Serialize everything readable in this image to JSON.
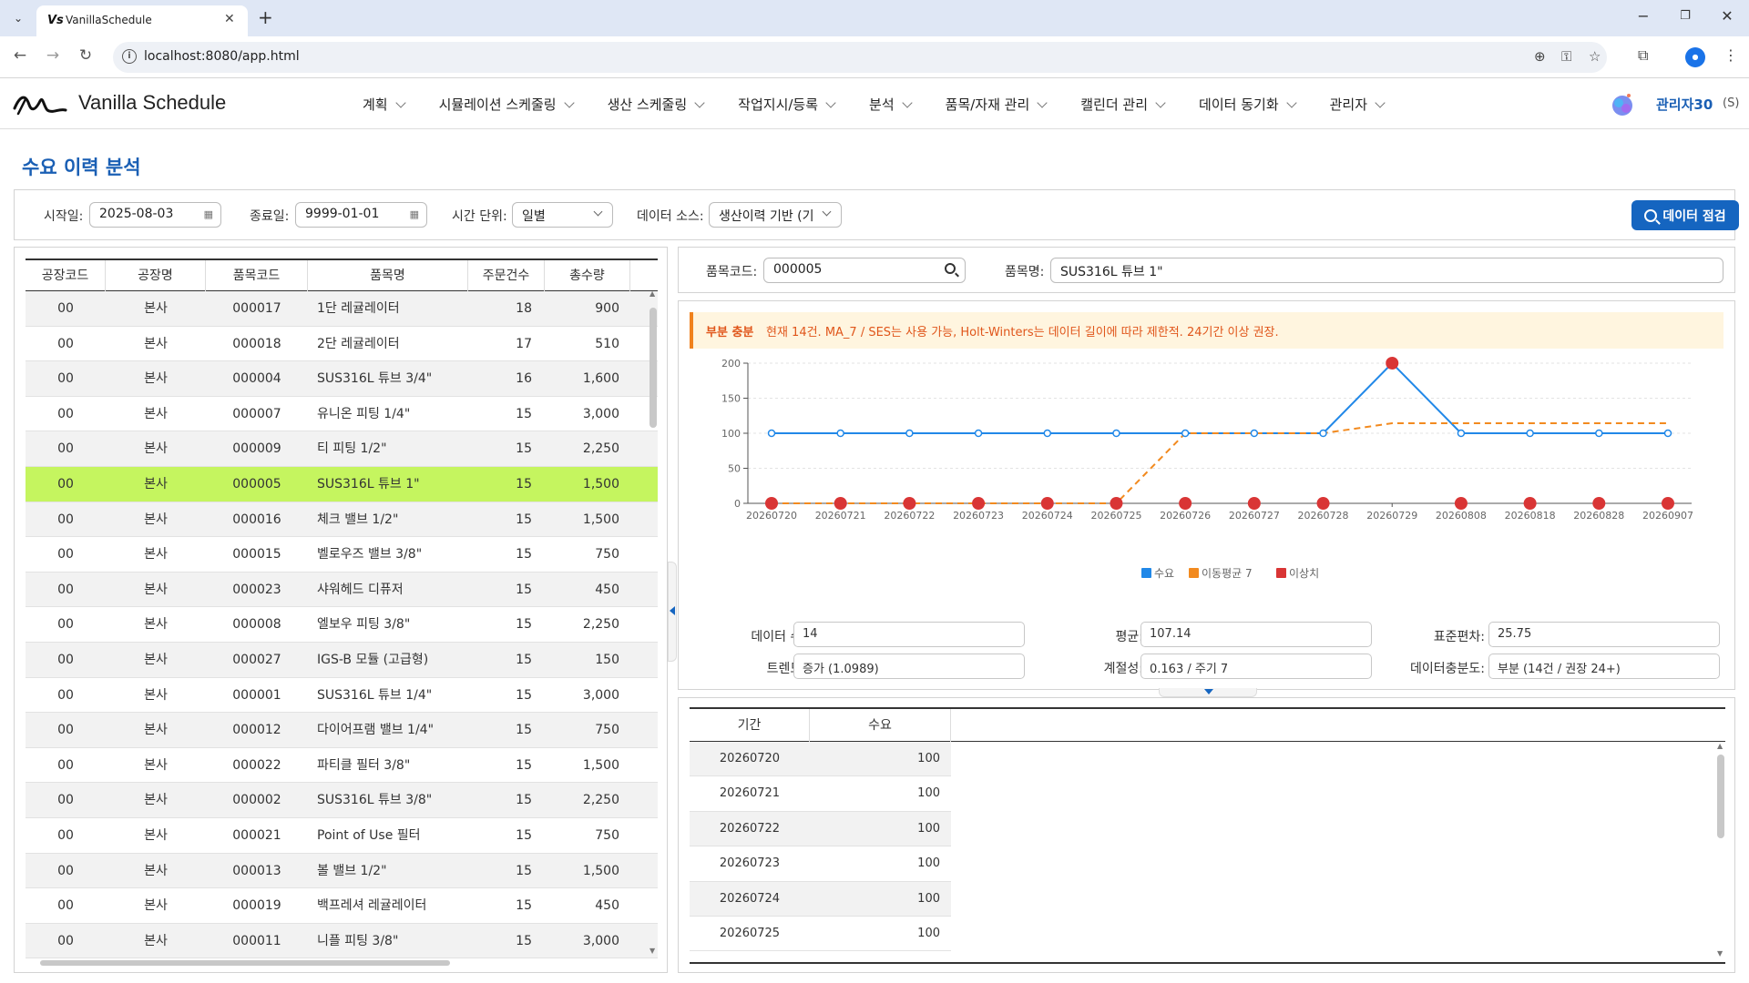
{
  "browser": {
    "tab_title": "VanillaSchedule",
    "url": "localhost:8080/app.html"
  },
  "app": {
    "brand": "Vanilla Schedule",
    "menu": [
      "계획",
      "시뮬레이션 스케줄링",
      "생산 스케줄링",
      "작업지시/등록",
      "분석",
      "품목/자재 관리",
      "캘린더 관리",
      "데이터 동기화",
      "관리자"
    ],
    "user_name": "관리자30",
    "user_suffix": "(S)"
  },
  "page": {
    "title": "수요 이력 분석"
  },
  "filters": {
    "start_label": "시작일:",
    "start_value": "2025-08-03",
    "end_label": "종료일:",
    "end_value": "9999-01-01",
    "unit_label": "시간 단위:",
    "unit_value": "일별",
    "source_label": "데이터 소스:",
    "source_value": "생산이력 기반 (기",
    "check_button": "데이터 점검"
  },
  "left_grid": {
    "columns": [
      "공장코드",
      "공장명",
      "품목코드",
      "품목명",
      "주문건수",
      "총수량"
    ],
    "selected_index": 5,
    "rows": [
      [
        "00",
        "본사",
        "000017",
        "1단 레귤레이터",
        "18",
        "900"
      ],
      [
        "00",
        "본사",
        "000018",
        "2단 레귤레이터",
        "17",
        "510"
      ],
      [
        "00",
        "본사",
        "000004",
        "SUS316L 튜브 3/4\"",
        "16",
        "1,600"
      ],
      [
        "00",
        "본사",
        "000007",
        "유니온 피팅 1/4\"",
        "15",
        "3,000"
      ],
      [
        "00",
        "본사",
        "000009",
        "티 피팅 1/2\"",
        "15",
        "2,250"
      ],
      [
        "00",
        "본사",
        "000005",
        "SUS316L 튜브 1\"",
        "15",
        "1,500"
      ],
      [
        "00",
        "본사",
        "000016",
        "체크 밸브 1/2\"",
        "15",
        "1,500"
      ],
      [
        "00",
        "본사",
        "000015",
        "벨로우즈 밸브 3/8\"",
        "15",
        "750"
      ],
      [
        "00",
        "본사",
        "000023",
        "샤워헤드 디퓨저",
        "15",
        "450"
      ],
      [
        "00",
        "본사",
        "000008",
        "엘보우 피팅 3/8\"",
        "15",
        "2,250"
      ],
      [
        "00",
        "본사",
        "000027",
        "IGS-B 모듈 (고급형)",
        "15",
        "150"
      ],
      [
        "00",
        "본사",
        "000001",
        "SUS316L 튜브 1/4\"",
        "15",
        "3,000"
      ],
      [
        "00",
        "본사",
        "000012",
        "다이어프램 밸브 1/4\"",
        "15",
        "750"
      ],
      [
        "00",
        "본사",
        "000022",
        "파티클 필터 3/8\"",
        "15",
        "1,500"
      ],
      [
        "00",
        "본사",
        "000002",
        "SUS316L 튜브 3/8\"",
        "15",
        "2,250"
      ],
      [
        "00",
        "본사",
        "000021",
        "Point of Use 필터",
        "15",
        "750"
      ],
      [
        "00",
        "본사",
        "000013",
        "볼 밸브 1/2\"",
        "15",
        "1,500"
      ],
      [
        "00",
        "본사",
        "000019",
        "백프레셔 레귤레이터",
        "15",
        "450"
      ],
      [
        "00",
        "본사",
        "000011",
        "니플 피팅 3/8\"",
        "15",
        "3,000"
      ]
    ]
  },
  "item_search": {
    "code_label": "품목코드:",
    "code_value": "000005",
    "name_label": "품목명:",
    "name_value": "SUS316L 튜브 1\""
  },
  "warning": {
    "tag": "부분 충분",
    "message": "현재 14건. MA_7 / SES는 사용 가능, Holt-Winters는 데이터 길이에 따라 제한적. 24기간 이상 권장."
  },
  "chart_data": {
    "type": "line",
    "x": [
      "20260720",
      "20260721",
      "20260722",
      "20260723",
      "20260724",
      "20260725",
      "20260726",
      "20260727",
      "20260728",
      "20260729",
      "20260808",
      "20260818",
      "20260828",
      "20260907"
    ],
    "yticks": [
      0,
      50,
      100,
      150,
      200
    ],
    "ylim": [
      0,
      200
    ],
    "series": [
      {
        "name": "수요",
        "color": "#2188e8",
        "values": [
          100,
          100,
          100,
          100,
          100,
          100,
          100,
          100,
          100,
          200,
          100,
          100,
          100,
          100
        ]
      },
      {
        "name": "이동평균 7",
        "color": "#f28a1f",
        "values": [
          0,
          0,
          0,
          0,
          0,
          0,
          100,
          100,
          100,
          114.29,
          114.29,
          114.29,
          114.29,
          114.29
        ]
      },
      {
        "name": "이상치",
        "color": "#d93535",
        "values": [
          0,
          0,
          0,
          0,
          0,
          0,
          0,
          0,
          0,
          200,
          0,
          0,
          0,
          0
        ]
      }
    ],
    "grid": true,
    "legend": "bottom"
  },
  "stats": {
    "count_label": "데이터 수:",
    "count_value": "14",
    "mean_label": "평균:",
    "mean_value": "107.14",
    "std_label": "표준편차:",
    "std_value": "25.75",
    "trend_label": "트렌드:",
    "trend_value": "증가 (1.0989)",
    "season_label": "계절성:",
    "season_value": "0.163 / 주기 7",
    "suff_label": "데이터충분도:",
    "suff_value": "부분 (14건 / 권장 24+)"
  },
  "bottom_grid": {
    "columns": [
      "기간",
      "수요"
    ],
    "rows": [
      [
        "20260720",
        "100"
      ],
      [
        "20260721",
        "100"
      ],
      [
        "20260722",
        "100"
      ],
      [
        "20260723",
        "100"
      ],
      [
        "20260724",
        "100"
      ],
      [
        "20260725",
        "100"
      ]
    ]
  }
}
